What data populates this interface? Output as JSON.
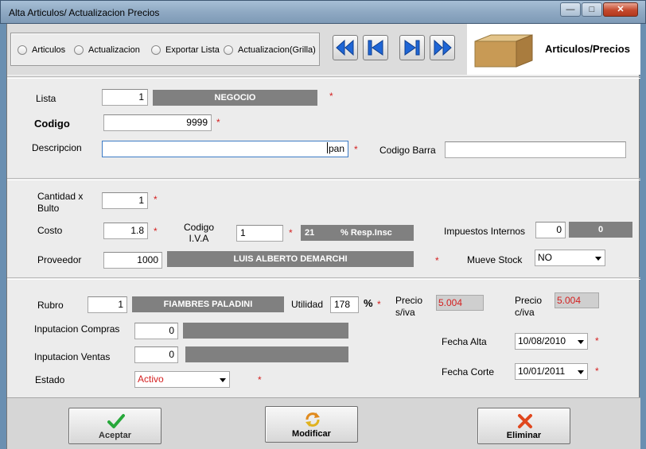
{
  "window": {
    "title": "Alta Articulos/ Actualizacion Precios"
  },
  "modes": [
    {
      "label": "Articulos"
    },
    {
      "label": "Actualizacion"
    },
    {
      "label": "Exportar Lista"
    },
    {
      "label": "Actualizacion(Grilla)"
    }
  ],
  "brand": {
    "title": "Articulos/Precios"
  },
  "icons": {
    "first": "double-left-arrow-icon",
    "prev": "skip-back-icon",
    "next": "skip-forward-icon",
    "last": "double-right-arrow-icon",
    "logo": "cardboard-box-icon"
  },
  "form": {
    "lista_label": "Lista",
    "lista_value": "1",
    "lista_name": "NEGOCIO",
    "codigo_label": "Codigo",
    "codigo_value": "9999",
    "descripcion_label": "Descripcion",
    "descripcion_value": "pan",
    "codigo_barra_label": "Codigo Barra",
    "codigo_barra_value": "",
    "cantidad_label_1": "Cantidad x",
    "cantidad_label_2": "Bulto",
    "cantidad_value": "1",
    "costo_label": "Costo",
    "costo_value": "1.8",
    "codigo_iva_label_1": "Codigo",
    "codigo_iva_label_2": "I.V.A",
    "codigo_iva_value": "1",
    "iva_rate": "21",
    "iva_desc": "% Resp.Insc",
    "impuestos_label": "Impuestos Internos",
    "impuestos_value": "0",
    "impuestos_display": "0",
    "proveedor_label": "Proveedor",
    "proveedor_value": "1000",
    "proveedor_name": "LUIS ALBERTO DEMARCHI",
    "mueve_stock_label": "Mueve Stock",
    "mueve_stock_value": "NO",
    "rubro_label": "Rubro",
    "rubro_value": "1",
    "rubro_name": "FIAMBRES PALADINI",
    "utilidad_label": "Utilidad",
    "utilidad_value": "178",
    "utilidad_unit": "%",
    "precio_siva_label_1": "Precio",
    "precio_siva_label_2": "s/iva",
    "precio_siva_value": "5.004",
    "precio_civa_label_1": "Precio",
    "precio_civa_label_2": "c/iva",
    "precio_civa_value": "5.004",
    "imp_compras_label": "Inputacion Compras",
    "imp_compras_value": "0",
    "imp_compras_name": "",
    "imp_ventas_label": "Inputacion Ventas",
    "imp_ventas_value": "0",
    "imp_ventas_name": "",
    "estado_label": "Estado",
    "estado_value": "Activo",
    "fecha_alta_label": "Fecha Alta",
    "fecha_alta_value": "10/08/2010",
    "fecha_corte_label": "Fecha Corte",
    "fecha_corte_value": "10/01/2011",
    "required_mark": "*"
  },
  "actions": {
    "aceptar": "Aceptar",
    "modificar": "Modificar",
    "eliminar": "Eliminar"
  },
  "colors": {
    "required": "#d41f1f",
    "readonly_bg": "#808080",
    "nav_blue": "#1f66d6"
  }
}
